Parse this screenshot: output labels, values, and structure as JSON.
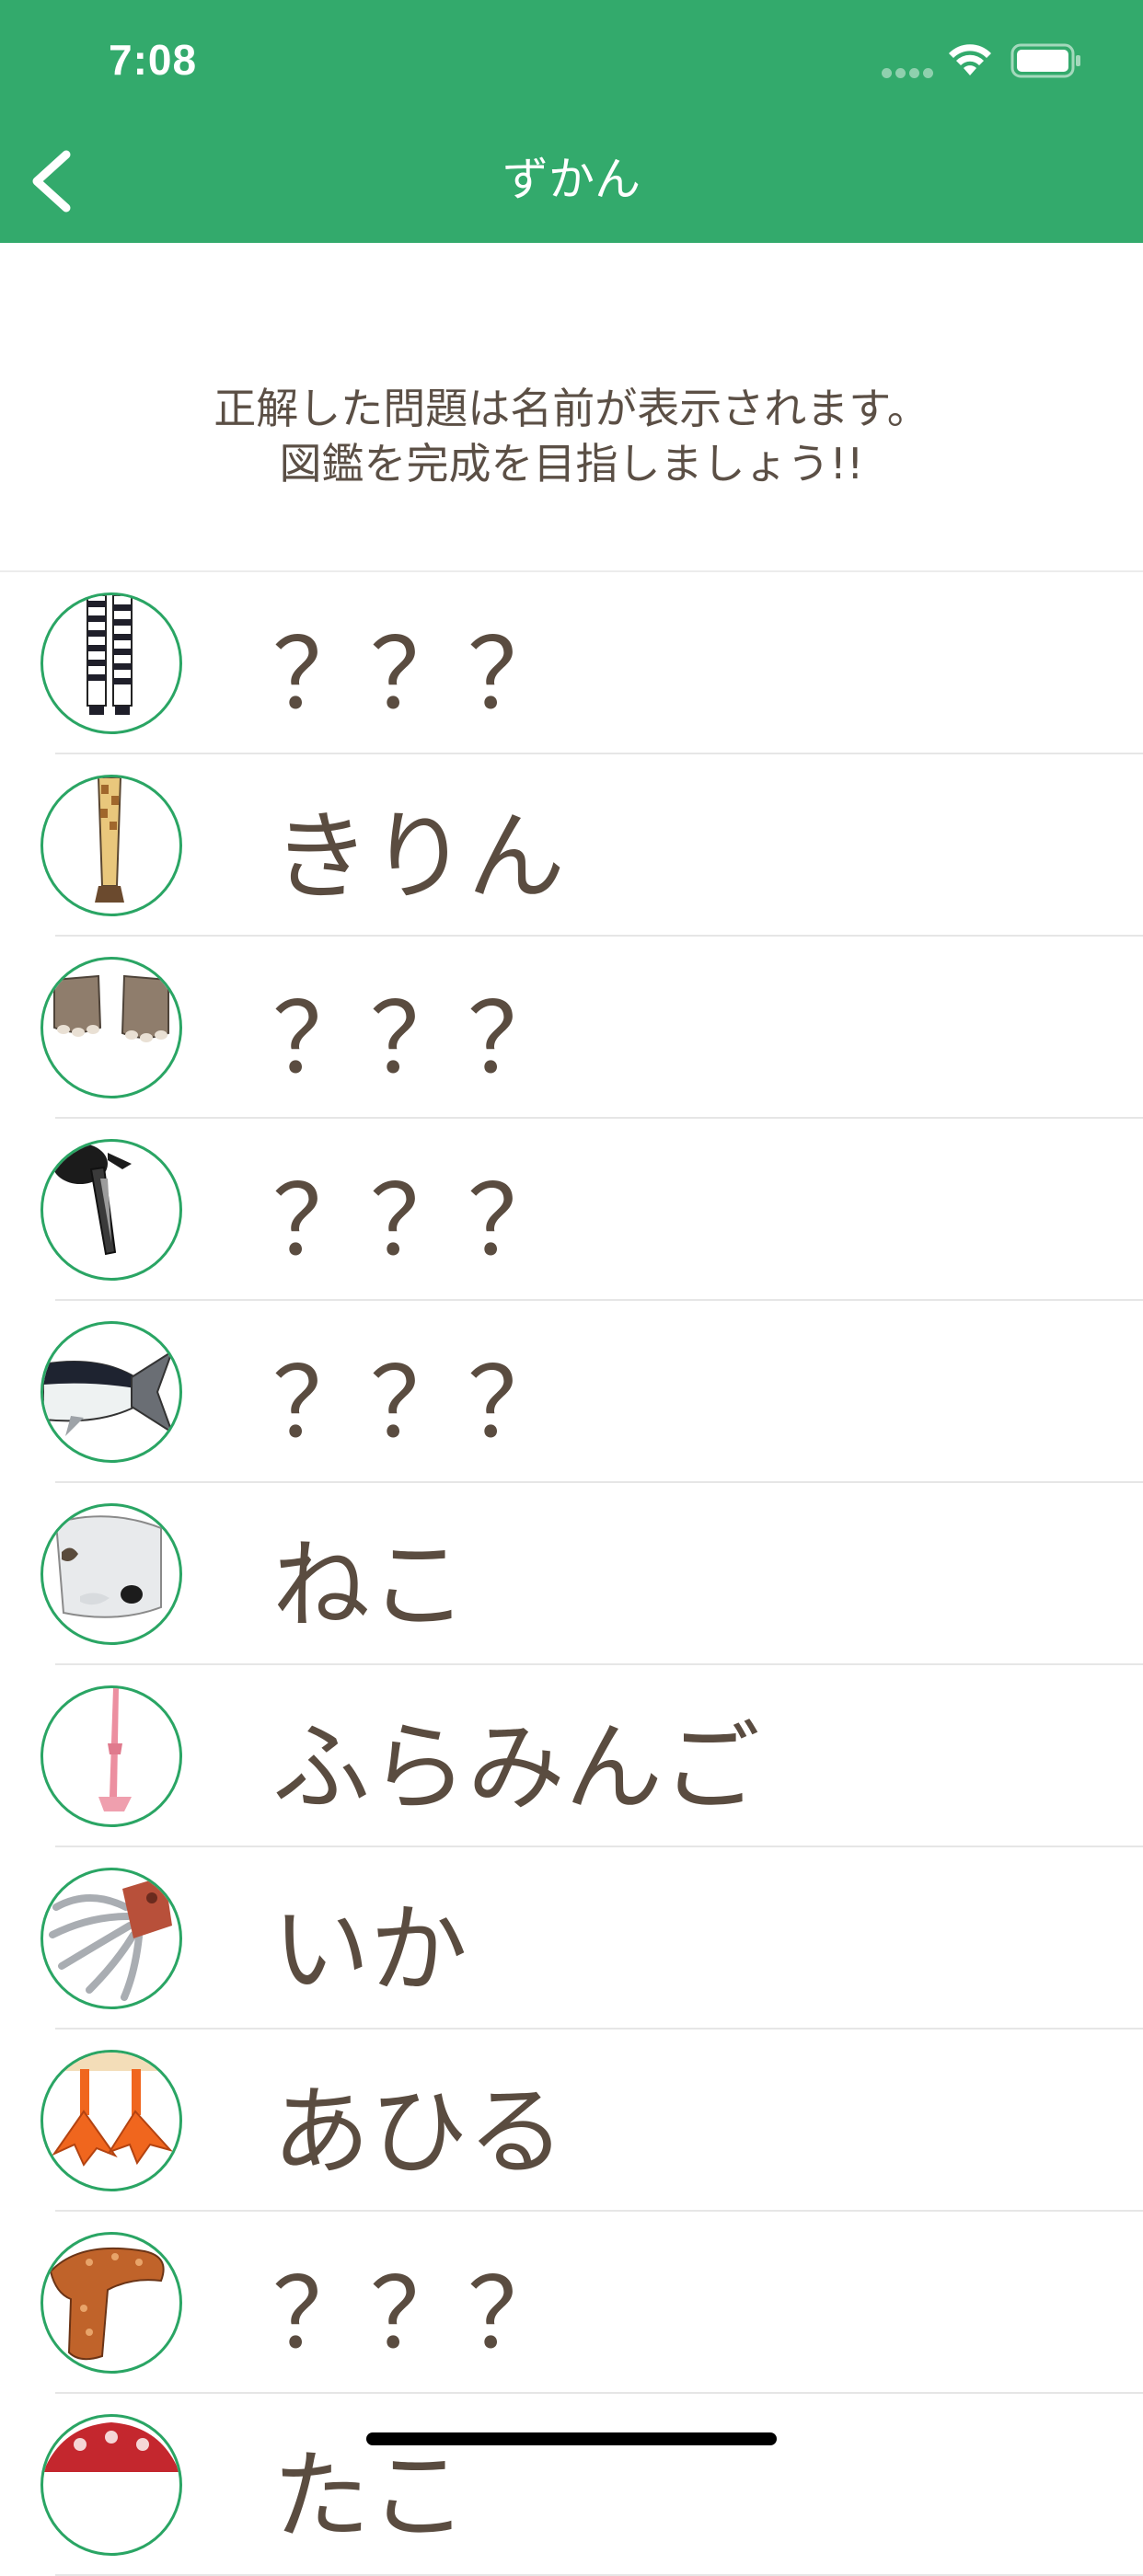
{
  "status_bar": {
    "time": "7:08"
  },
  "nav": {
    "title": "ずかん",
    "back_icon": "chevron-left-icon"
  },
  "intro": {
    "line1": "正解した問題は名前が表示されます。",
    "line2": "図鑑を完成を目指しましょう!!"
  },
  "colors": {
    "accent": "#33aa6c",
    "ring": "#2aa564",
    "text": "#5a4c40"
  },
  "animals": [
    {
      "name": "？？？",
      "icon": "zebra-legs-icon"
    },
    {
      "name": "きりん",
      "icon": "giraffe-leg-icon"
    },
    {
      "name": "？？？",
      "icon": "elephant-feet-icon"
    },
    {
      "name": "？？？",
      "icon": "bird-beak-icon"
    },
    {
      "name": "？？？",
      "icon": "tuna-tail-icon"
    },
    {
      "name": "ねこ",
      "icon": "cat-paw-icon"
    },
    {
      "name": "ふらみんご",
      "icon": "flamingo-leg-icon"
    },
    {
      "name": "いか",
      "icon": "squid-tentacles-icon"
    },
    {
      "name": "あひる",
      "icon": "duck-feet-icon"
    },
    {
      "name": "？？？",
      "icon": "sea-cucumber-icon"
    },
    {
      "name": "たこ",
      "icon": "octopus-icon"
    }
  ]
}
